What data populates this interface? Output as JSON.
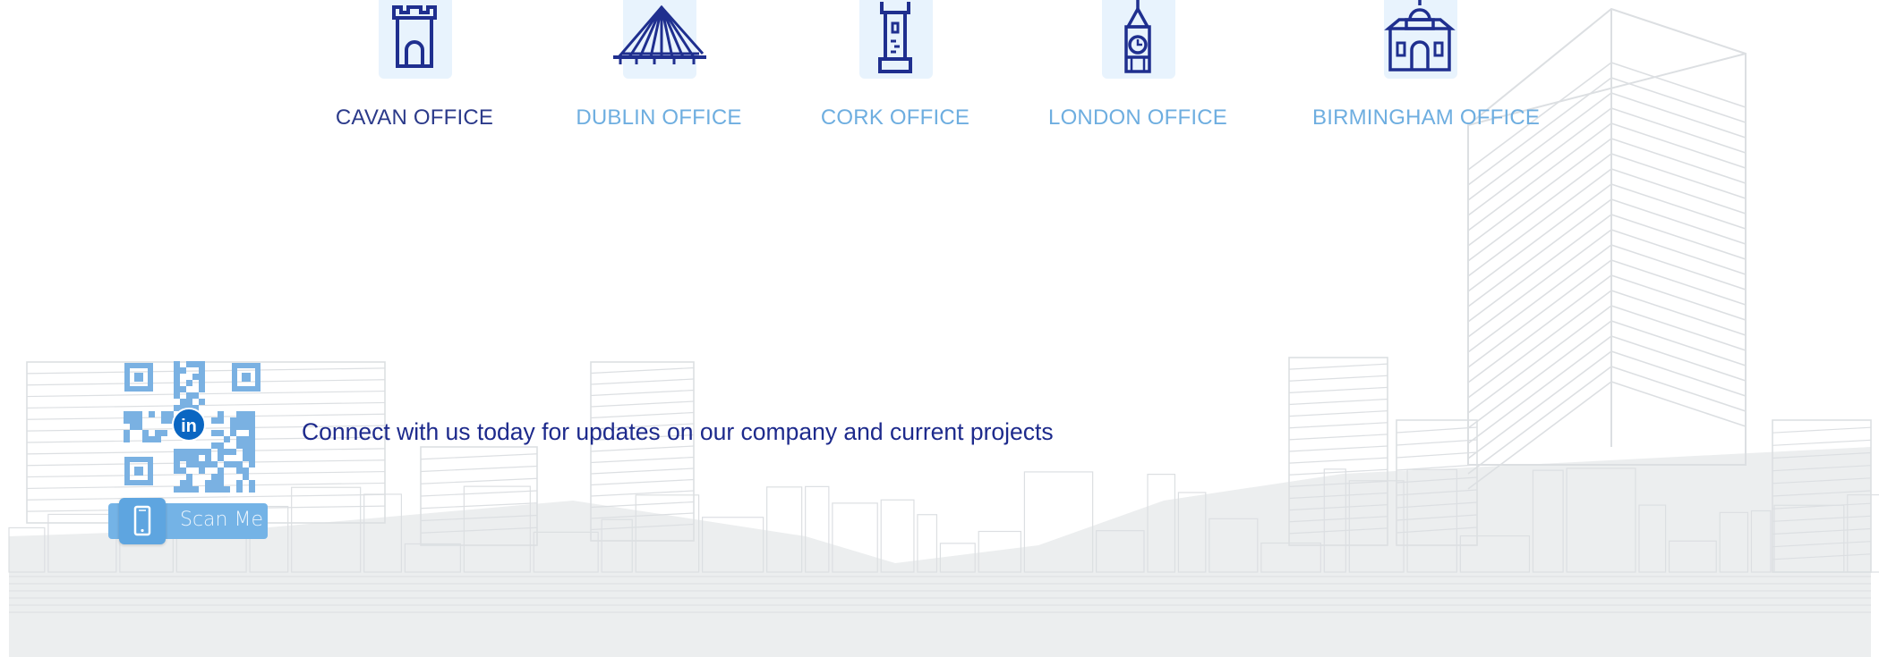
{
  "colors": {
    "active_office": "#2b3a8a",
    "inactive_office": "#6eaee0",
    "icon_stroke": "#1f2f8f",
    "icon_tile": "#e8f3fd",
    "qr_blue": "#7ab1e2",
    "linkedin": "#0a66c2",
    "connect_text": "#1d2a8c",
    "skyline_line": "#dcdfe2",
    "skyline_fill": "#eceeef"
  },
  "offices": [
    {
      "label": "CAVAN OFFICE",
      "icon": "castle-tower-icon",
      "active": true
    },
    {
      "label": "DUBLIN OFFICE",
      "icon": "bridge-icon",
      "active": false
    },
    {
      "label": "CORK OFFICE",
      "icon": "lighthouse-tower-icon",
      "active": false
    },
    {
      "label": "LONDON OFFICE",
      "icon": "big-ben-icon",
      "active": false
    },
    {
      "label": "BIRMINGHAM OFFICE",
      "icon": "domed-building-icon",
      "active": false
    }
  ],
  "connect": {
    "text": "Connect with us today for updates on our company and current projects",
    "qr_icon": "linkedin-icon",
    "scan_label": "Scan Me",
    "scan_icon": "smartphone-icon"
  }
}
